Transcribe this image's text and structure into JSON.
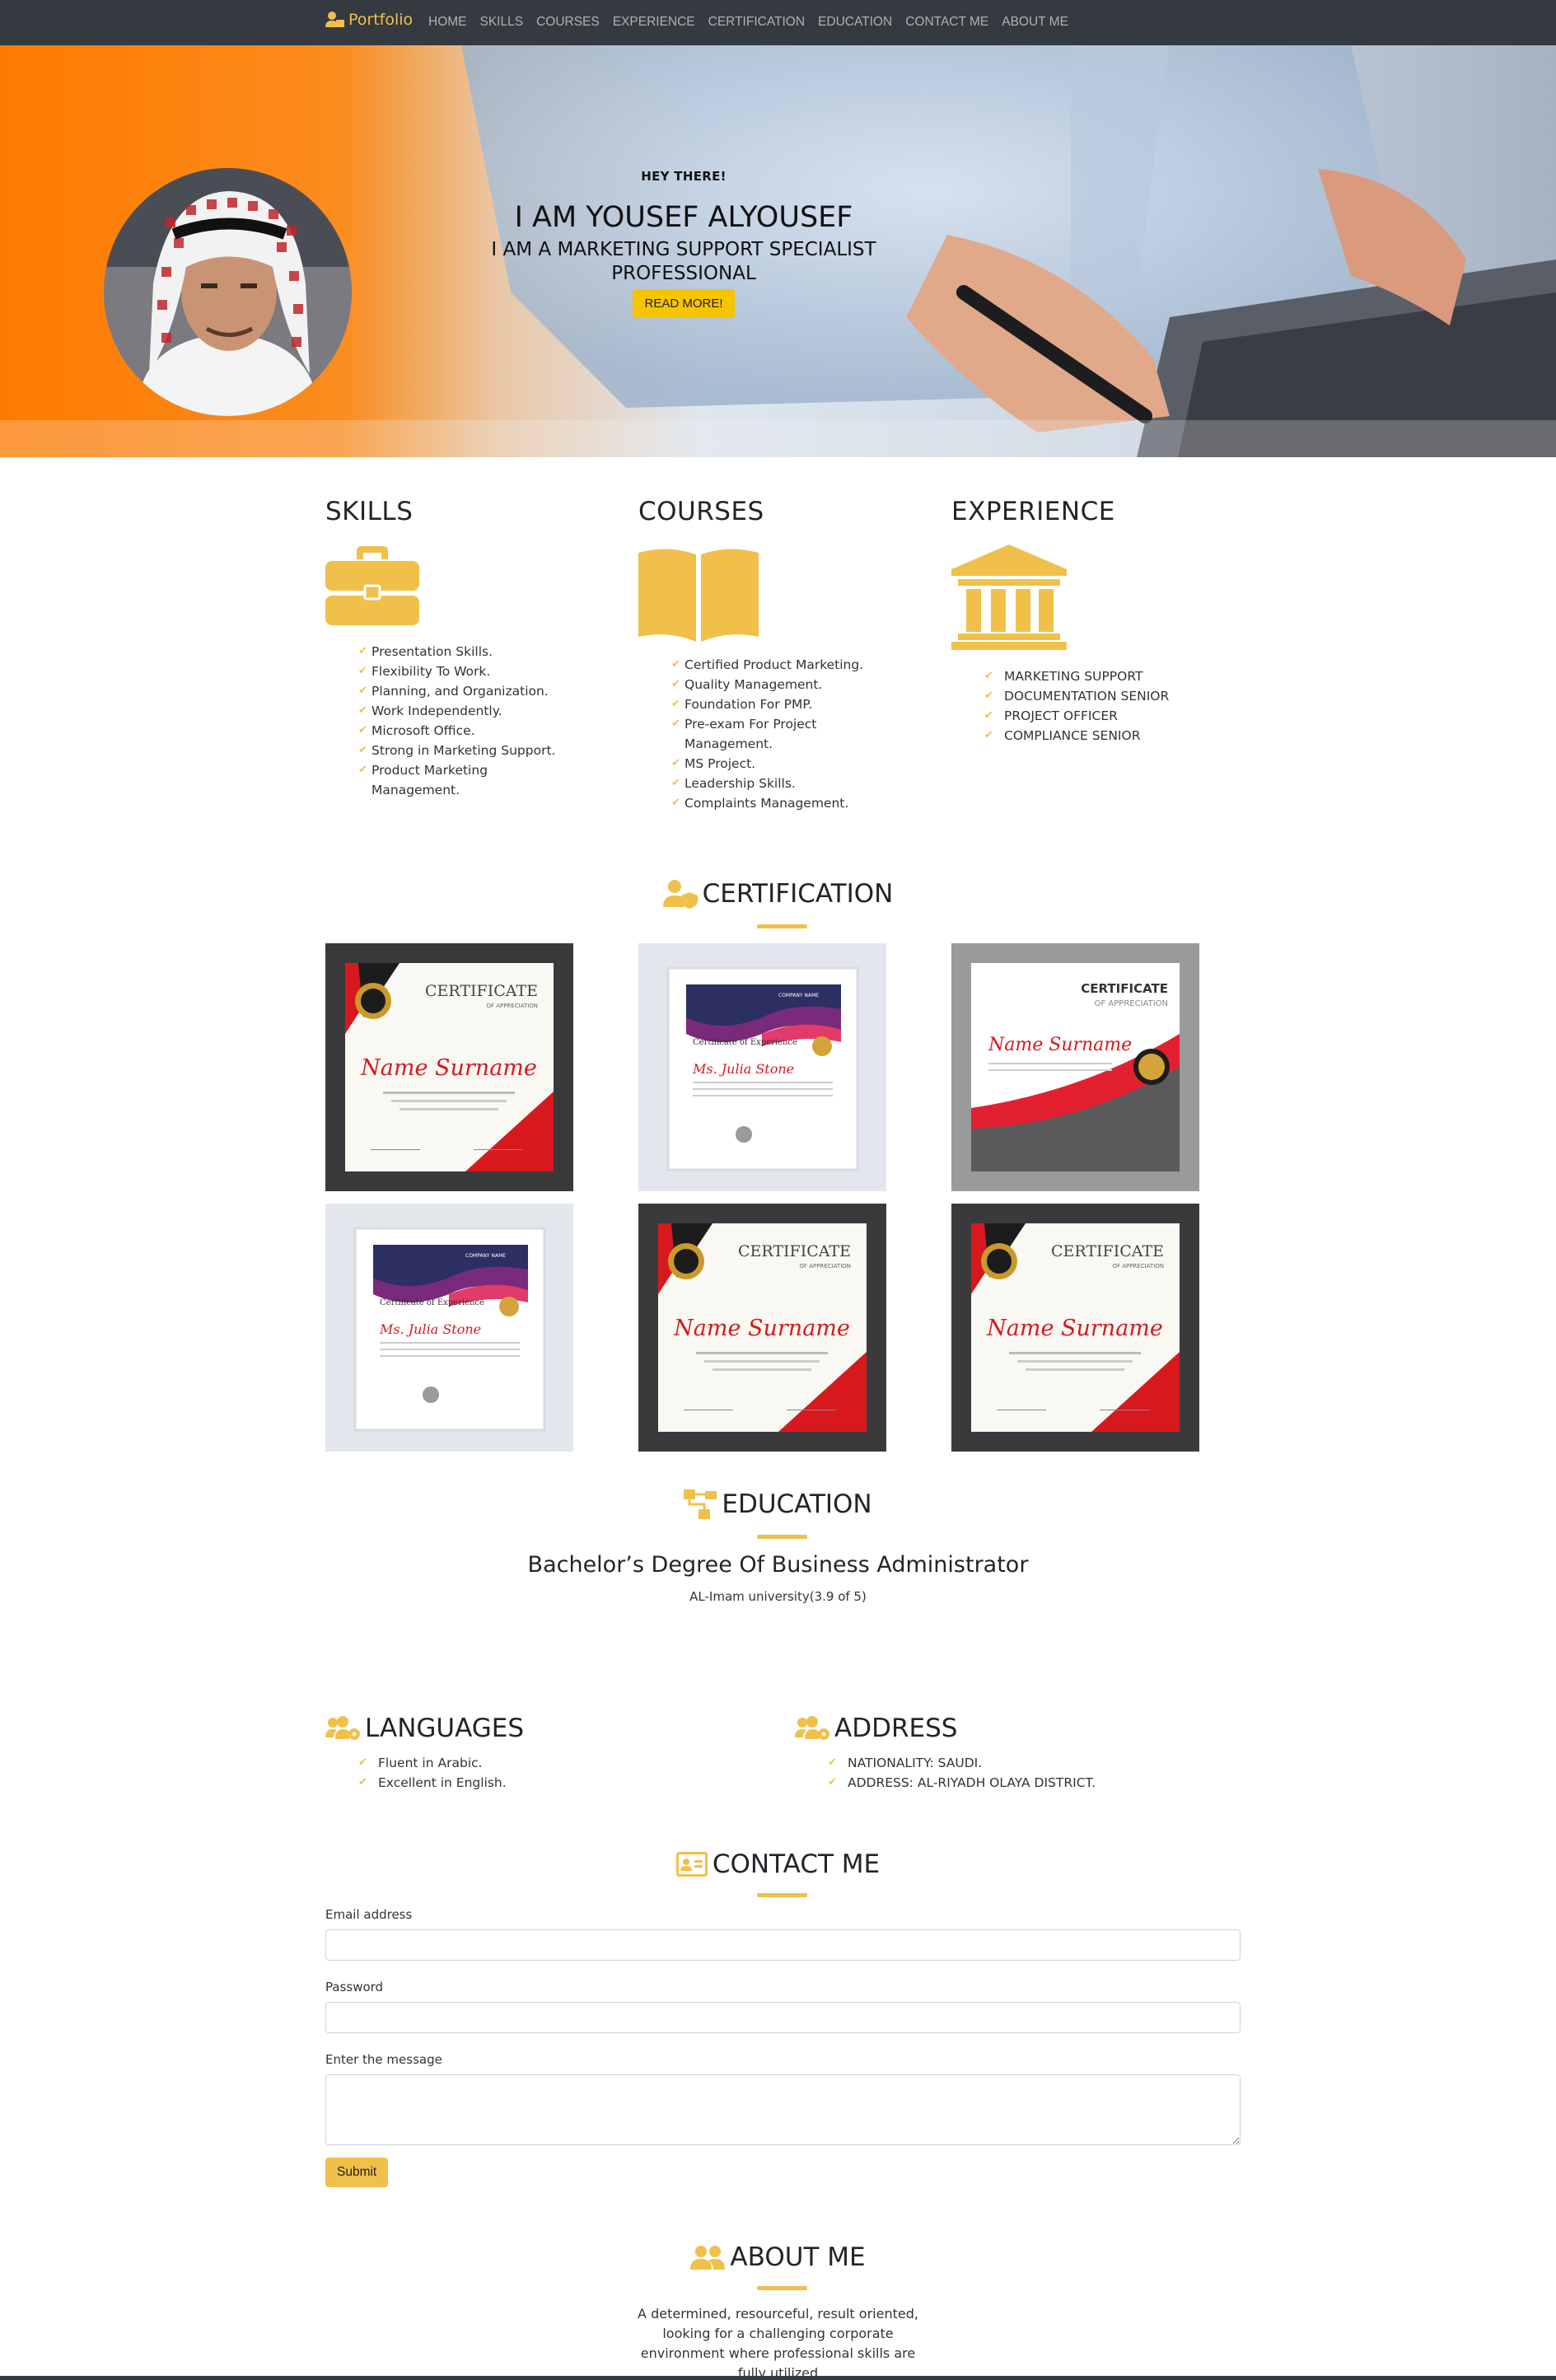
{
  "nav": {
    "brand": "Portfolio",
    "links": [
      "HOME",
      "SKILLS",
      "COURSES",
      "EXPERIENCE",
      "CERTIFICATION",
      "EDUCATION",
      "CONTACT ME",
      "ABOUT ME"
    ]
  },
  "hero": {
    "eyebrow": "HEY THERE!",
    "name": "I AM YOUSEF ALYOUSEF",
    "role": "I AM A MARKETING SUPPORT SPECIALIST PROFESSIONAL",
    "button": "READ MORE!"
  },
  "skills": {
    "title": "SKILLS",
    "icon": "briefcase-icon",
    "items": [
      "Presentation Skills.",
      "Flexibility To Work.",
      "Planning, and Organization.",
      "Work Independently.",
      "Microsoft Office.",
      "Strong in Marketing Support.",
      "Product Marketing Management."
    ]
  },
  "courses": {
    "title": "COURSES",
    "icon": "open-book-icon",
    "items": [
      "Certified Product Marketing.",
      "Quality Management.",
      "Foundation For PMP.",
      "Pre-exam For Project Management.",
      "MS Project.",
      "Leadership Skills.",
      "Complaints Management."
    ]
  },
  "experience": {
    "title": "EXPERIENCE",
    "icon": "institution-icon",
    "items": [
      "MARKETING SUPPORT",
      "DOCUMENTATION SENIOR",
      "PROJECT OFFICER",
      "COMPLIANCE SENIOR"
    ]
  },
  "certification": {
    "title": "CERTIFICATION",
    "icon": "user-shield-icon",
    "certificates": [
      {
        "heading": "CERTIFICATE",
        "sub": "OF APPRECIATION",
        "name": "Name Surname"
      },
      {
        "heading": "Certificate of Experience",
        "sub": "COMPANY NAME",
        "name": "Ms. Julia Stone"
      },
      {
        "heading": "CERTIFICATE",
        "sub": "OF APPRECIATION",
        "name": "Name Surname"
      },
      {
        "heading": "Certificate of Experience",
        "sub": "COMPANY NAME",
        "name": "Ms. Julia Stone"
      },
      {
        "heading": "CERTIFICATE",
        "sub": "OF APPRECIATION",
        "name": "Name Surname"
      },
      {
        "heading": "CERTIFICATE",
        "sub": "OF APPRECIATION",
        "name": "Name Surname"
      }
    ]
  },
  "education": {
    "title": "EDUCATION",
    "icon": "sitemap-icon",
    "degree": "Bachelor’s Degree Of Business Administrator",
    "school": "AL-Imam university(3.9 of 5)"
  },
  "languages": {
    "title": "LANGUAGES",
    "icon": "users-cog-icon",
    "items": [
      "Fluent in Arabic.",
      "Excellent in English."
    ]
  },
  "address": {
    "title": "ADDRESS",
    "icon": "users-cog-icon",
    "items": [
      "NATIONALITY: SAUDI.",
      "ADDRESS: AL-RIYADH OLAYA DISTRICT."
    ]
  },
  "contact": {
    "title": "CONTACT ME",
    "icon": "id-card-icon",
    "email_label": "Email address",
    "password_label": "Password",
    "message_label": "Enter the message",
    "submit": "Submit"
  },
  "about": {
    "title": "ABOUT ME",
    "icon": "users-icon",
    "text": "A determined, resourceful, result oriented, looking for a challenging corporate environment where professional skills are fully utilized"
  },
  "colors": {
    "accent": "#f0c04a",
    "navbar": "#343a40",
    "hero_orange": "#ff7a00",
    "button_yellow": "#f7c400"
  }
}
